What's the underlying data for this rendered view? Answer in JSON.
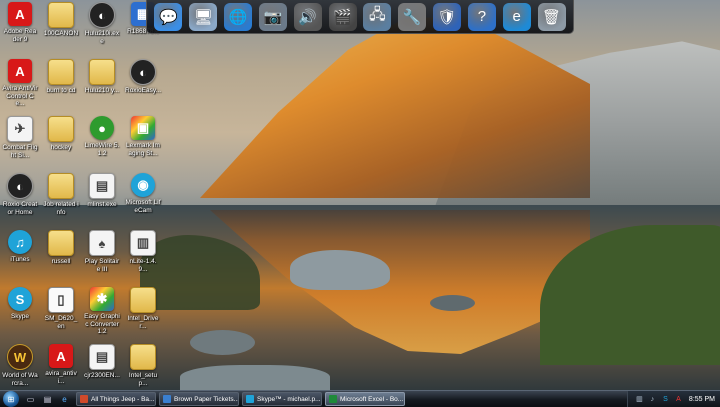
{
  "desktop": {
    "icons": [
      {
        "name": "adobe-reader",
        "label": "Adobe Reader 9",
        "icon": "adobe-reader-icon",
        "glyph": "A",
        "style": "red"
      },
      {
        "name": "100canon-folder",
        "label": "100CANON",
        "icon": "folder-icon",
        "glyph": "",
        "style": "folder"
      },
      {
        "name": "hulu",
        "label": "Hulu210i.exe",
        "icon": "hulu-icon",
        "glyph": "◐",
        "style": "black"
      },
      {
        "name": "r186878",
        "label": "R186878.e",
        "icon": "installer-icon",
        "glyph": "▦",
        "style": "blue"
      },
      {
        "name": "avira-antivir",
        "label": "Avira AntiVir Control Ce...",
        "icon": "avira-icon",
        "glyph": "A",
        "style": "red"
      },
      {
        "name": "burn-to-cd",
        "label": "burn to cd",
        "icon": "folder-icon",
        "glyph": "",
        "style": "folder"
      },
      {
        "name": "hulu-folder",
        "label": "Hulu210 y...",
        "icon": "folder-icon",
        "glyph": "",
        "style": "folder"
      },
      {
        "name": "roxio-easy",
        "label": "RoxioEasy...",
        "icon": "roxio-icon",
        "glyph": "◐",
        "style": "black"
      },
      {
        "name": "combat-flight",
        "label": "Combat Flight Si...",
        "icon": "combat-flight-icon",
        "glyph": "✈",
        "style": "white"
      },
      {
        "name": "hockey",
        "label": "hockey",
        "icon": "folder-icon",
        "glyph": "",
        "style": "folder"
      },
      {
        "name": "limewire",
        "label": "LimeWire 5.1.2",
        "icon": "limewire-icon",
        "glyph": "●",
        "style": "green"
      },
      {
        "name": "lexmark",
        "label": "Lexmark Imaging St...",
        "icon": "lexmark-icon",
        "glyph": "▣",
        "style": "multi"
      },
      {
        "name": "roxio-creator",
        "label": "Roxio Creator Home",
        "icon": "roxio-creator-icon",
        "glyph": "◐",
        "style": "black"
      },
      {
        "name": "job-related-info",
        "label": "Job related info",
        "icon": "folder-icon",
        "glyph": "",
        "style": "folder"
      },
      {
        "name": "mlinst",
        "label": "mlinst.exe",
        "icon": "installer-icon",
        "glyph": "▤",
        "style": "white"
      },
      {
        "name": "microsoft-lifecam",
        "label": "Microsoft LifeCam",
        "icon": "webcam-icon",
        "glyph": "◉",
        "style": "cyan"
      },
      {
        "name": "itunes",
        "label": "iTunes",
        "icon": "itunes-icon",
        "glyph": "♫",
        "style": "cyan"
      },
      {
        "name": "russell",
        "label": "russell",
        "icon": "folder-icon",
        "glyph": "",
        "style": "folder"
      },
      {
        "name": "play-solitaire",
        "label": "Play Solitaire III",
        "icon": "solitaire-icon",
        "glyph": "♠",
        "style": "white"
      },
      {
        "name": "nlite",
        "label": "nLite-1.4.9...",
        "icon": "nlite-icon",
        "glyph": "▥",
        "style": "white"
      },
      {
        "name": "skype",
        "label": "Skype",
        "icon": "skype-icon",
        "glyph": "S",
        "style": "cyan"
      },
      {
        "name": "sm-d620",
        "label": "SM_D620_en",
        "icon": "document-icon",
        "glyph": "▯",
        "style": "doc"
      },
      {
        "name": "easy-graphic-converter",
        "label": "Easy Graphic Converter 1.2",
        "icon": "converter-icon",
        "glyph": "✱",
        "style": "multi"
      },
      {
        "name": "intel-driver",
        "label": "Intel_Driver...",
        "icon": "folder-icon",
        "glyph": "",
        "style": "folder"
      },
      {
        "name": "world-of-warcraft",
        "label": "World of Warcra...",
        "icon": "warcraft-icon",
        "glyph": "W",
        "style": "wow"
      },
      {
        "name": "avira-antivir-setup",
        "label": "avira_antivi...",
        "icon": "avira-icon",
        "glyph": "A",
        "style": "red"
      },
      {
        "name": "cjr2300en",
        "label": "cjr2300EN...",
        "icon": "installer-icon",
        "glyph": "▤",
        "style": "white"
      },
      {
        "name": "intel-setup",
        "label": "Intel_setup...",
        "icon": "folder-icon",
        "glyph": "",
        "style": "folder"
      }
    ]
  },
  "dock": {
    "items": [
      {
        "name": "messenger",
        "icon": "chat-bubble-icon",
        "glyph": "💬",
        "color": "#3a8ee6"
      },
      {
        "name": "computer",
        "icon": "computer-icon",
        "glyph": "🖥",
        "color": "#8aa8c8"
      },
      {
        "name": "network",
        "icon": "globe-icon",
        "glyph": "🌐",
        "color": "#2a7bd0"
      },
      {
        "name": "camera",
        "icon": "camera-icon",
        "glyph": "📷",
        "color": "#6b7a8a"
      },
      {
        "name": "speaker",
        "icon": "speaker-icon",
        "glyph": "🔊",
        "color": "#555"
      },
      {
        "name": "video",
        "icon": "clapperboard-icon",
        "glyph": "🎬",
        "color": "#444"
      },
      {
        "name": "network-places",
        "icon": "network-icon",
        "glyph": "🖧",
        "color": "#5a7ea0"
      },
      {
        "name": "tools",
        "icon": "tools-icon",
        "glyph": "🔧",
        "color": "#777"
      },
      {
        "name": "security",
        "icon": "shield-icon",
        "glyph": "🛡",
        "color": "#2e63b8"
      },
      {
        "name": "help",
        "icon": "help-icon",
        "glyph": "?",
        "color": "#2e70c8"
      },
      {
        "name": "internet-explorer",
        "icon": "internet-explorer-icon",
        "glyph": "e",
        "color": "#1e8ad6"
      },
      {
        "name": "recycle-bin",
        "icon": "recycle-bin-icon",
        "glyph": "🗑",
        "color": "#8d9aa6"
      }
    ]
  },
  "taskbar": {
    "tasks": [
      {
        "name": "task-all-things-jeep",
        "label": "All Things Jeep - Ba...",
        "icon_color": "#d04a2a",
        "active": false
      },
      {
        "name": "task-brown-paper-tickets",
        "label": "Brown Paper Tickets...",
        "icon_color": "#3a7fd0",
        "active": false
      },
      {
        "name": "task-skype",
        "label": "Skype™ - michael.p...",
        "icon_color": "#1fa3d8",
        "active": false
      },
      {
        "name": "task-microsoft-excel",
        "label": "Microsoft Excel - Bo...",
        "icon_color": "#1f8a3a",
        "active": true
      }
    ],
    "clock": "8:55 PM"
  }
}
